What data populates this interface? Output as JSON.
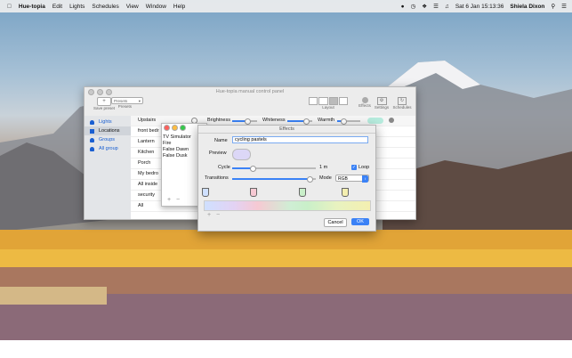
{
  "menubar": {
    "apple_icon": "apple-icon",
    "app_name": "Hue-topia",
    "items": [
      "Edit",
      "Lights",
      "Schedules",
      "View",
      "Window",
      "Help"
    ],
    "datetime": "Sat 6 Jan  15:13:36",
    "user": "Shiela Dixon"
  },
  "main_window": {
    "title": "Hue-topia manual control panel",
    "toolbar": {
      "save_preset": "Save preset",
      "presets_select": "Presets",
      "presets_label": "Presets",
      "layout": "Layout",
      "effects": "Effects",
      "settings": "Settings",
      "schedules": "Schedules"
    },
    "sidebar": [
      {
        "label": "Lights"
      },
      {
        "label": "Locations"
      },
      {
        "label": "Groups"
      },
      {
        "label": "All group"
      }
    ],
    "header": {
      "group": "Upstairs",
      "brightness": "Brightness",
      "whiteness": "Whiteness",
      "warmth": "Warmth"
    },
    "rooms": [
      "front bedr",
      "Lantern",
      "Kitchen",
      "Porch",
      "My bedro",
      "All inside",
      "security",
      "All"
    ]
  },
  "effects_window": {
    "list": [
      "TV Simulator",
      "Fire",
      "False Dawn",
      "False Dusk"
    ],
    "add": "+",
    "remove": "−"
  },
  "effect_sheet": {
    "title": "Effects",
    "name_label": "Name",
    "name_value": "cycling pastels",
    "preview_label": "Preview",
    "cycle_label": "Cycle",
    "cycle_value": "1 m",
    "loop_label": "Loop",
    "loop_checked": true,
    "transitions_label": "Transitions",
    "mode_label": "Mode",
    "mode_value": "RGB",
    "add": "+",
    "remove": "−",
    "cancel": "Cancel",
    "ok": "OK",
    "accent": "#3b82f6"
  }
}
